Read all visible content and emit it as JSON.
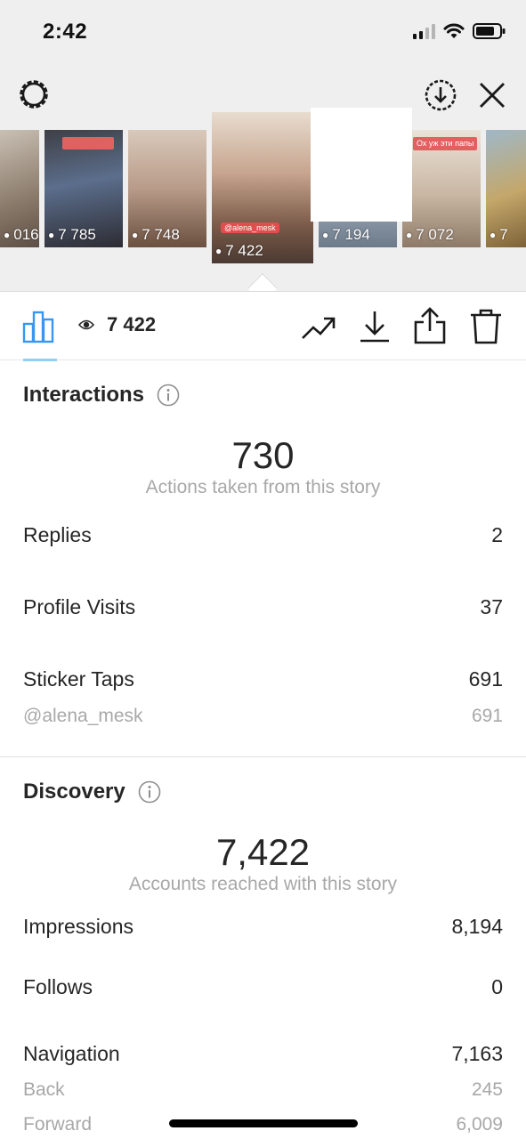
{
  "status": {
    "time": "2:42"
  },
  "thumbnails": [
    {
      "views": "016",
      "color": "#8a7a6a"
    },
    {
      "views": "7 785",
      "color": "#5b6e8c"
    },
    {
      "views": "7 748",
      "color": "#b89b88"
    },
    {
      "views": "7 422",
      "color": "#c7a58f",
      "handle": "@alena_mesk"
    },
    {
      "views": "7 194",
      "color": "#9aa8b6"
    },
    {
      "views": "7 072",
      "color": "#c9b6a3",
      "caption": "Ох уж эти папы"
    },
    {
      "views": "7",
      "color": "#c4a76a"
    }
  ],
  "toolbar": {
    "views_total": "7 422"
  },
  "interactions": {
    "title": "Interactions",
    "total": "730",
    "caption": "Actions taken from this story",
    "rows": [
      {
        "label": "Replies",
        "value": "2"
      },
      {
        "label": "Profile Visits",
        "value": "37"
      },
      {
        "label": "Sticker Taps",
        "value": "691"
      }
    ],
    "sub_rows": [
      {
        "label": "@alena_mesk",
        "value": "691"
      }
    ]
  },
  "discovery": {
    "title": "Discovery",
    "total": "7,422",
    "caption": "Accounts reached with this story",
    "rows": [
      {
        "label": "Impressions",
        "value": "8,194"
      },
      {
        "label": "Follows",
        "value": "0"
      },
      {
        "label": "Navigation",
        "value": "7,163"
      }
    ],
    "sub_rows": [
      {
        "label": "Back",
        "value": "245"
      },
      {
        "label": "Forward",
        "value": "6,009"
      }
    ]
  },
  "colors": {
    "accent": "#3897f0",
    "muted": "#a8a8a8",
    "text": "#262626"
  }
}
